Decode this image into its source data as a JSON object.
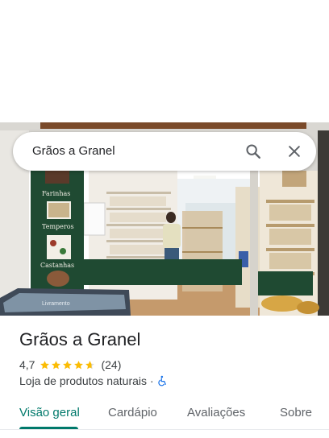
{
  "search": {
    "query": "Grãos a Granel"
  },
  "place": {
    "name": "Grãos a Granel",
    "rating": "4,7",
    "rating_value": 4.7,
    "review_count": "(24)",
    "category": "Loja de produtos naturais",
    "separator": "·",
    "accessibility_icon": "wheelchair-accessible-icon"
  },
  "photo_signs": {
    "farinhas": "Farinhas",
    "temperos": "Temperos",
    "castanhas": "Castanhas",
    "freezer": "Livramento"
  },
  "tabs": [
    {
      "label": "Visão geral",
      "active": true
    },
    {
      "label": "Cardápio",
      "active": false
    },
    {
      "label": "Avaliações",
      "active": false
    },
    {
      "label": "Sobre",
      "active": false
    }
  ],
  "colors": {
    "accent": "#00796b",
    "star": "#fbbc04",
    "accessibility": "#1a73e8",
    "store_green": "#1f4a32"
  }
}
